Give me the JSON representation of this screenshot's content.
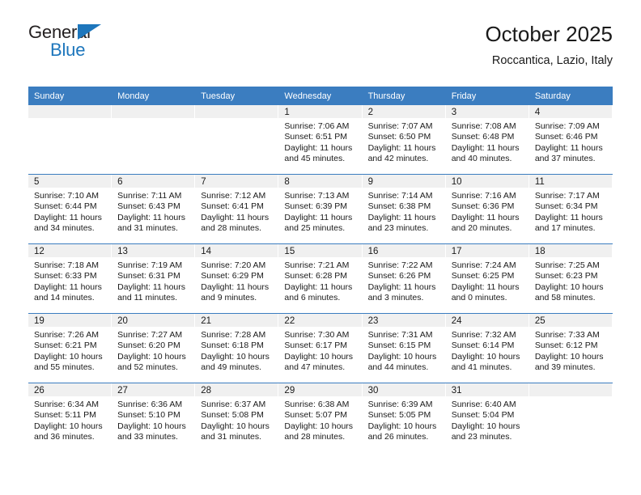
{
  "brand": {
    "name_top": "General",
    "name_bottom": "Blue",
    "triangle_color": "#1d76bc"
  },
  "header": {
    "title": "October 2025",
    "subtitle": "Roccantica, Lazio, Italy"
  },
  "colors": {
    "header_blue": "#3b7dc0",
    "daynum_band": "#f0f0f0",
    "text": "#1a1a1a"
  },
  "labels": {
    "sunrise": "Sunrise:",
    "sunset": "Sunset:",
    "daylight": "Daylight:"
  },
  "weekdays": [
    "Sunday",
    "Monday",
    "Tuesday",
    "Wednesday",
    "Thursday",
    "Friday",
    "Saturday"
  ],
  "weeks": [
    [
      {
        "day": ""
      },
      {
        "day": ""
      },
      {
        "day": ""
      },
      {
        "day": "1",
        "sunrise": "Sunrise: 7:06 AM",
        "sunset": "Sunset: 6:51 PM",
        "daylight_1": "Daylight: 11 hours",
        "daylight_2": "and 45 minutes."
      },
      {
        "day": "2",
        "sunrise": "Sunrise: 7:07 AM",
        "sunset": "Sunset: 6:50 PM",
        "daylight_1": "Daylight: 11 hours",
        "daylight_2": "and 42 minutes."
      },
      {
        "day": "3",
        "sunrise": "Sunrise: 7:08 AM",
        "sunset": "Sunset: 6:48 PM",
        "daylight_1": "Daylight: 11 hours",
        "daylight_2": "and 40 minutes."
      },
      {
        "day": "4",
        "sunrise": "Sunrise: 7:09 AM",
        "sunset": "Sunset: 6:46 PM",
        "daylight_1": "Daylight: 11 hours",
        "daylight_2": "and 37 minutes."
      }
    ],
    [
      {
        "day": "5",
        "sunrise": "Sunrise: 7:10 AM",
        "sunset": "Sunset: 6:44 PM",
        "daylight_1": "Daylight: 11 hours",
        "daylight_2": "and 34 minutes."
      },
      {
        "day": "6",
        "sunrise": "Sunrise: 7:11 AM",
        "sunset": "Sunset: 6:43 PM",
        "daylight_1": "Daylight: 11 hours",
        "daylight_2": "and 31 minutes."
      },
      {
        "day": "7",
        "sunrise": "Sunrise: 7:12 AM",
        "sunset": "Sunset: 6:41 PM",
        "daylight_1": "Daylight: 11 hours",
        "daylight_2": "and 28 minutes."
      },
      {
        "day": "8",
        "sunrise": "Sunrise: 7:13 AM",
        "sunset": "Sunset: 6:39 PM",
        "daylight_1": "Daylight: 11 hours",
        "daylight_2": "and 25 minutes."
      },
      {
        "day": "9",
        "sunrise": "Sunrise: 7:14 AM",
        "sunset": "Sunset: 6:38 PM",
        "daylight_1": "Daylight: 11 hours",
        "daylight_2": "and 23 minutes."
      },
      {
        "day": "10",
        "sunrise": "Sunrise: 7:16 AM",
        "sunset": "Sunset: 6:36 PM",
        "daylight_1": "Daylight: 11 hours",
        "daylight_2": "and 20 minutes."
      },
      {
        "day": "11",
        "sunrise": "Sunrise: 7:17 AM",
        "sunset": "Sunset: 6:34 PM",
        "daylight_1": "Daylight: 11 hours",
        "daylight_2": "and 17 minutes."
      }
    ],
    [
      {
        "day": "12",
        "sunrise": "Sunrise: 7:18 AM",
        "sunset": "Sunset: 6:33 PM",
        "daylight_1": "Daylight: 11 hours",
        "daylight_2": "and 14 minutes."
      },
      {
        "day": "13",
        "sunrise": "Sunrise: 7:19 AM",
        "sunset": "Sunset: 6:31 PM",
        "daylight_1": "Daylight: 11 hours",
        "daylight_2": "and 11 minutes."
      },
      {
        "day": "14",
        "sunrise": "Sunrise: 7:20 AM",
        "sunset": "Sunset: 6:29 PM",
        "daylight_1": "Daylight: 11 hours",
        "daylight_2": "and 9 minutes."
      },
      {
        "day": "15",
        "sunrise": "Sunrise: 7:21 AM",
        "sunset": "Sunset: 6:28 PM",
        "daylight_1": "Daylight: 11 hours",
        "daylight_2": "and 6 minutes."
      },
      {
        "day": "16",
        "sunrise": "Sunrise: 7:22 AM",
        "sunset": "Sunset: 6:26 PM",
        "daylight_1": "Daylight: 11 hours",
        "daylight_2": "and 3 minutes."
      },
      {
        "day": "17",
        "sunrise": "Sunrise: 7:24 AM",
        "sunset": "Sunset: 6:25 PM",
        "daylight_1": "Daylight: 11 hours",
        "daylight_2": "and 0 minutes."
      },
      {
        "day": "18",
        "sunrise": "Sunrise: 7:25 AM",
        "sunset": "Sunset: 6:23 PM",
        "daylight_1": "Daylight: 10 hours",
        "daylight_2": "and 58 minutes."
      }
    ],
    [
      {
        "day": "19",
        "sunrise": "Sunrise: 7:26 AM",
        "sunset": "Sunset: 6:21 PM",
        "daylight_1": "Daylight: 10 hours",
        "daylight_2": "and 55 minutes."
      },
      {
        "day": "20",
        "sunrise": "Sunrise: 7:27 AM",
        "sunset": "Sunset: 6:20 PM",
        "daylight_1": "Daylight: 10 hours",
        "daylight_2": "and 52 minutes."
      },
      {
        "day": "21",
        "sunrise": "Sunrise: 7:28 AM",
        "sunset": "Sunset: 6:18 PM",
        "daylight_1": "Daylight: 10 hours",
        "daylight_2": "and 49 minutes."
      },
      {
        "day": "22",
        "sunrise": "Sunrise: 7:30 AM",
        "sunset": "Sunset: 6:17 PM",
        "daylight_1": "Daylight: 10 hours",
        "daylight_2": "and 47 minutes."
      },
      {
        "day": "23",
        "sunrise": "Sunrise: 7:31 AM",
        "sunset": "Sunset: 6:15 PM",
        "daylight_1": "Daylight: 10 hours",
        "daylight_2": "and 44 minutes."
      },
      {
        "day": "24",
        "sunrise": "Sunrise: 7:32 AM",
        "sunset": "Sunset: 6:14 PM",
        "daylight_1": "Daylight: 10 hours",
        "daylight_2": "and 41 minutes."
      },
      {
        "day": "25",
        "sunrise": "Sunrise: 7:33 AM",
        "sunset": "Sunset: 6:12 PM",
        "daylight_1": "Daylight: 10 hours",
        "daylight_2": "and 39 minutes."
      }
    ],
    [
      {
        "day": "26",
        "sunrise": "Sunrise: 6:34 AM",
        "sunset": "Sunset: 5:11 PM",
        "daylight_1": "Daylight: 10 hours",
        "daylight_2": "and 36 minutes."
      },
      {
        "day": "27",
        "sunrise": "Sunrise: 6:36 AM",
        "sunset": "Sunset: 5:10 PM",
        "daylight_1": "Daylight: 10 hours",
        "daylight_2": "and 33 minutes."
      },
      {
        "day": "28",
        "sunrise": "Sunrise: 6:37 AM",
        "sunset": "Sunset: 5:08 PM",
        "daylight_1": "Daylight: 10 hours",
        "daylight_2": "and 31 minutes."
      },
      {
        "day": "29",
        "sunrise": "Sunrise: 6:38 AM",
        "sunset": "Sunset: 5:07 PM",
        "daylight_1": "Daylight: 10 hours",
        "daylight_2": "and 28 minutes."
      },
      {
        "day": "30",
        "sunrise": "Sunrise: 6:39 AM",
        "sunset": "Sunset: 5:05 PM",
        "daylight_1": "Daylight: 10 hours",
        "daylight_2": "and 26 minutes."
      },
      {
        "day": "31",
        "sunrise": "Sunrise: 6:40 AM",
        "sunset": "Sunset: 5:04 PM",
        "daylight_1": "Daylight: 10 hours",
        "daylight_2": "and 23 minutes."
      },
      {
        "day": ""
      }
    ]
  ]
}
